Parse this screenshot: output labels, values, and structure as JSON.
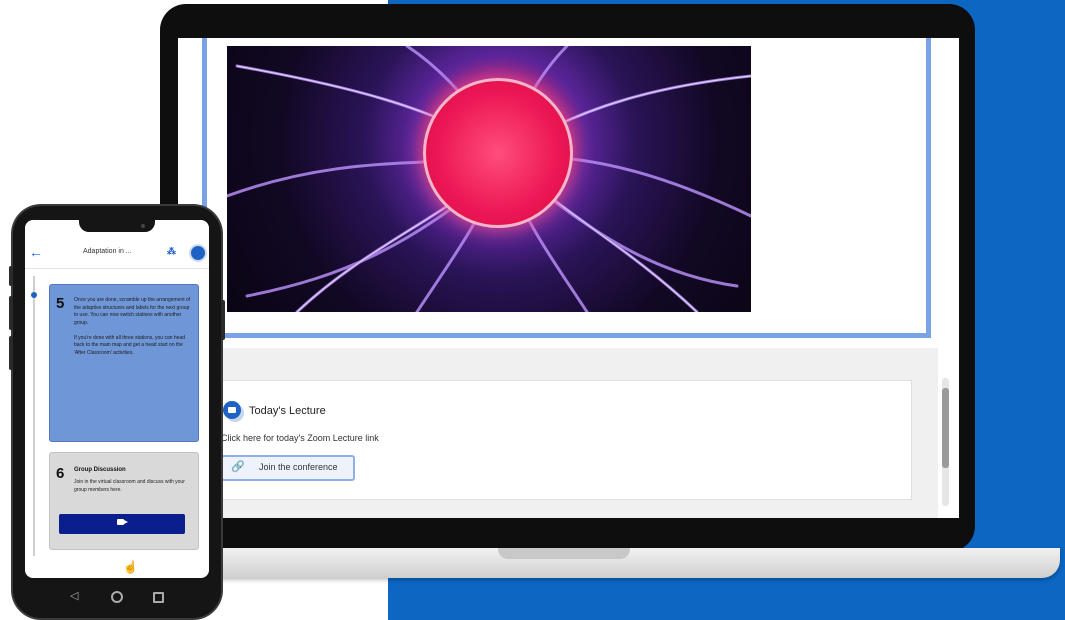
{
  "laptop": {
    "lecture_title": "Today's Lecture",
    "lecture_desc": "Click here for today's Zoom Lecture link",
    "join_label": "Join the conference"
  },
  "phone": {
    "title": "Adaptation in ...",
    "step5": {
      "number": "5",
      "text": "Once you are done, scramble up the arrangement of the adaptive structures and labels for the next group to use. You can now switch stations with another group.\n\nIf you're done with all three stations, you can head back to the main map and get a head start on the 'After Classroom' activities."
    },
    "step6": {
      "number": "6",
      "title": "Group Discussion",
      "text": "Join in the virtual classroom and discuss with your group members here."
    }
  },
  "colors": {
    "brand_blue": "#0c66c2",
    "card_border": "#7aa3e5",
    "step_active": "#6f97d8",
    "video_button": "#0b1f8c"
  }
}
